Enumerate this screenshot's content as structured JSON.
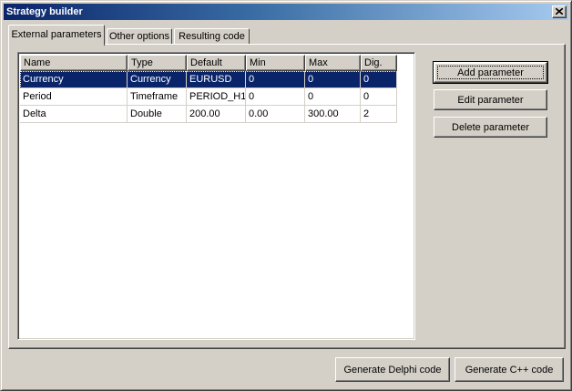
{
  "window": {
    "title": "Strategy builder",
    "close_icon": "close-icon"
  },
  "tabs": [
    {
      "label": "External parameters",
      "active": true
    },
    {
      "label": "Other options",
      "active": false
    },
    {
      "label": "Resulting code",
      "active": false
    }
  ],
  "table": {
    "columns": [
      "Name",
      "Type",
      "Default",
      "Min",
      "Max",
      "Dig."
    ],
    "rows": [
      {
        "cells": [
          "Currency",
          "Currency",
          "EURUSD",
          "0",
          "0",
          "0"
        ],
        "selected": true
      },
      {
        "cells": [
          "Period",
          "Timeframe",
          "PERIOD_H1",
          "0",
          "0",
          "0"
        ],
        "selected": false
      },
      {
        "cells": [
          "Delta",
          "Double",
          "200.00",
          "0.00",
          "300.00",
          "2"
        ],
        "selected": false
      }
    ]
  },
  "side_buttons": {
    "add": "Add parameter",
    "edit": "Edit parameter",
    "delete": "Delete parameter"
  },
  "footer_buttons": {
    "delphi": "Generate Delphi code",
    "cpp": "Generate C++ code"
  },
  "colors": {
    "face": "#d4d0c8",
    "selection": "#0a246a",
    "title_gradient_start": "#0a246a",
    "title_gradient_end": "#a6caf0"
  }
}
